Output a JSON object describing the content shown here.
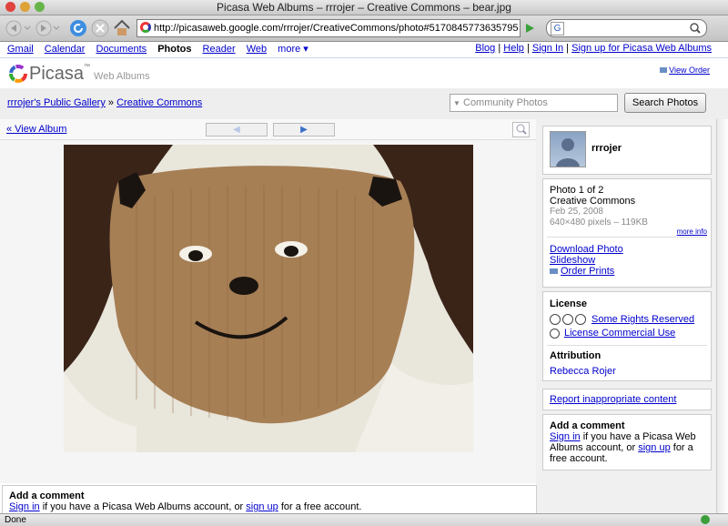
{
  "window": {
    "title": "Picasa Web Albums – rrrojer – Creative Commons – bear.jpg"
  },
  "browser": {
    "url": "http://picasaweb.google.com/rrrojer/CreativeCommons/photo#5170845773635795",
    "search_engine_letter": "G",
    "status": "Done"
  },
  "gbar": {
    "left": [
      "Gmail",
      "Calendar",
      "Documents",
      "Photos",
      "Reader",
      "Web",
      "more ▾"
    ],
    "active": "Photos",
    "right": [
      "Blog",
      "Help",
      "Sign In",
      "Sign up for Picasa Web Albums"
    ]
  },
  "header": {
    "logo_word": "Picasa",
    "logo_tm": "™",
    "logo_sub": "Web Albums",
    "view_order": "View Order"
  },
  "crumbs": {
    "gallery": "rrrojer's Public Gallery",
    "sep": " » ",
    "album": "Creative Commons"
  },
  "search": {
    "placeholder": "Community Photos",
    "button": "Search Photos"
  },
  "photo_nav": {
    "view_album": "« View Album",
    "prev_arrow": "◀",
    "next_arrow": "▶"
  },
  "owner": {
    "name": "rrrojer"
  },
  "photo_info": {
    "index": "Photo 1 of 2",
    "album": "Creative Commons",
    "date": "Feb 25, 2008",
    "size": "640×480 pixels – 119KB",
    "more_info": "more info",
    "download": "Download Photo",
    "slideshow": "Slideshow",
    "order_prints": "Order Prints"
  },
  "license": {
    "heading": "License",
    "rights": "Some Rights Reserved",
    "commercial": "License Commercial Use",
    "attribution_heading": "Attribution",
    "attribution_name": "Rebecca Rojer"
  },
  "report": "Report inappropriate content",
  "comment": {
    "heading": "Add a comment",
    "sign_in": "Sign in",
    "text1": " if you have a Picasa Web Albums account, or ",
    "sign_up": "sign up",
    "text2": " for a free account."
  },
  "colors": {
    "link": "#0000cc",
    "sweater_brown": "#a67f55",
    "sweater_white": "#e9e6dc",
    "hair": "#3a2418"
  }
}
